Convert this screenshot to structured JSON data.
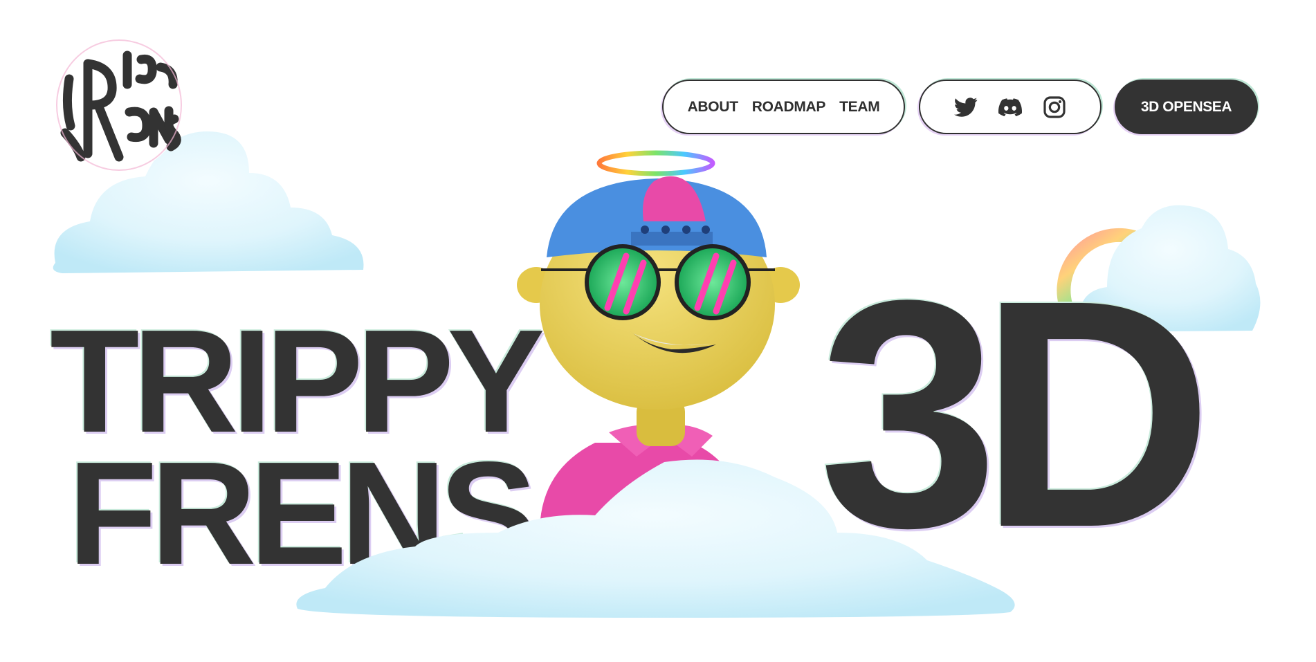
{
  "brand": {
    "logo_text": "TRIPPY FRENS",
    "logo_alt": "trippy-frens-logo"
  },
  "nav": {
    "links": [
      "ABOUT",
      "ROADMAP",
      "TEAM"
    ],
    "social": [
      "twitter-icon",
      "discord-icon",
      "instagram-icon"
    ],
    "cta_label": "3D OPENSEA"
  },
  "hero": {
    "line1": "TRIPPY",
    "line2": "FRENS",
    "big": "3D"
  },
  "colors": {
    "ink": "#333333",
    "cloud": "#d9f3fb",
    "skin": "#e8cf58",
    "cap": "#4a8fe0",
    "shirt": "#e84aa8",
    "lens": "#1fb85e"
  }
}
